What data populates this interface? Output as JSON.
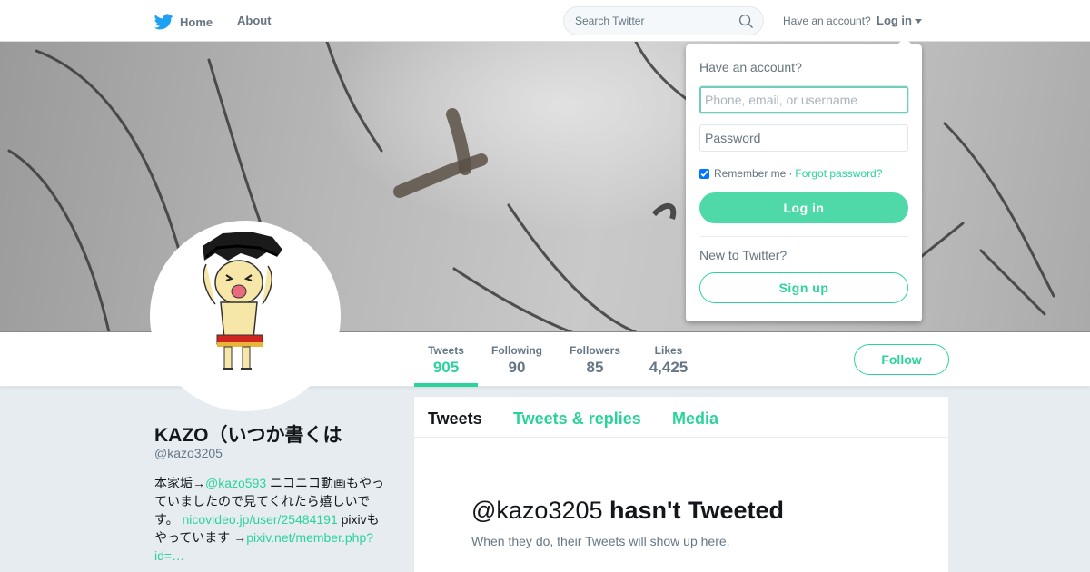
{
  "nav": {
    "home_label": "Home",
    "about_label": "About",
    "search_placeholder": "Search Twitter",
    "have_account": "Have an account?",
    "login_label": "Log in"
  },
  "colors": {
    "accent": "#2bd39c",
    "login_button": "#4fd9a8",
    "brand_bird": "#1da1f2",
    "page_bg": "#e6ecf0"
  },
  "stats": [
    {
      "label": "Tweets",
      "value": "905",
      "active": true
    },
    {
      "label": "Following",
      "value": "90",
      "active": false
    },
    {
      "label": "Followers",
      "value": "85",
      "active": false
    },
    {
      "label": "Likes",
      "value": "4,425",
      "active": false
    }
  ],
  "follow_label": "Follow",
  "profile": {
    "name": "KAZO（いつか書くは",
    "handle": "@kazo3205",
    "bio": {
      "t1": "本家垢→",
      "mention": "@kazo593",
      "t2": " ニコニコ動画もやっていましたので見てくれたら嬉しいです。 ",
      "link1": "nicovideo.jp/user/25484191",
      "t3": " pixivもやっています →",
      "link2": "pixiv.net/member.php?id=",
      "ellipsis": "…"
    }
  },
  "timeline": {
    "tabs": [
      "Tweets",
      "Tweets & replies",
      "Media"
    ],
    "empty_handle": "@kazo3205",
    "empty_title": "hasn't Tweeted",
    "empty_sub": "When they do, their Tweets will show up here."
  },
  "login_dropdown": {
    "heading": "Have an account?",
    "username_placeholder": "Phone, email, or username",
    "password_placeholder": "Password",
    "remember_label": "Remember me",
    "separator": "·",
    "forgot_label": "Forgot password?",
    "remember_checked": true,
    "login_button": "Log in",
    "new_label": "New to Twitter?",
    "signup_button": "Sign up"
  },
  "icons": {
    "brand": "twitter-bird-icon",
    "search": "search-icon",
    "dropdown": "caret-down-icon"
  }
}
